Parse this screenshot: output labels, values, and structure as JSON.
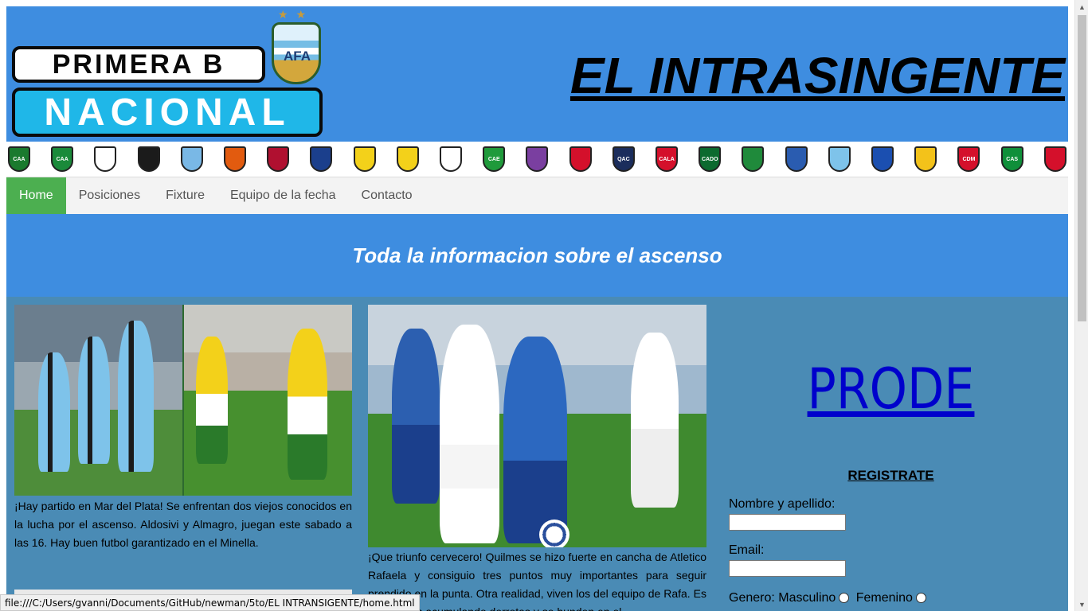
{
  "header": {
    "logo_line1": "PRIMERA B",
    "logo_line2": "NACIONAL",
    "logo_badge": "AFA",
    "site_title": "EL INTRASINGENTE"
  },
  "clubs": [
    {
      "name": "CAA",
      "color": "#1a7a2e"
    },
    {
      "name": "CAA",
      "color": "#1a8a3a"
    },
    {
      "name": "",
      "color": "#ffffff"
    },
    {
      "name": "",
      "color": "#1b1b1b"
    },
    {
      "name": "",
      "color": "#79b8e6"
    },
    {
      "name": "",
      "color": "#e25b0f"
    },
    {
      "name": "",
      "color": "#b01030"
    },
    {
      "name": "",
      "color": "#1b3f8c"
    },
    {
      "name": "",
      "color": "#f3d11a"
    },
    {
      "name": "",
      "color": "#f3d11a"
    },
    {
      "name": "",
      "color": "#ffffff"
    },
    {
      "name": "CAE",
      "color": "#1f9a3b"
    },
    {
      "name": "",
      "color": "#7a3fa0"
    },
    {
      "name": "",
      "color": "#d4102b"
    },
    {
      "name": "QAC",
      "color": "#1b2d5c"
    },
    {
      "name": "CALA",
      "color": "#d4102b"
    },
    {
      "name": "CADO",
      "color": "#0c6a2f"
    },
    {
      "name": "",
      "color": "#1f8a3b"
    },
    {
      "name": "",
      "color": "#2a5cb0"
    },
    {
      "name": "",
      "color": "#7ec3ea"
    },
    {
      "name": "",
      "color": "#1b4fb0"
    },
    {
      "name": "",
      "color": "#f3c21a"
    },
    {
      "name": "CDM",
      "color": "#d4102b"
    },
    {
      "name": "CAS",
      "color": "#0f8f3a"
    },
    {
      "name": "",
      "color": "#d4102b"
    }
  ],
  "nav": {
    "items": [
      "Home",
      "Posiciones",
      "Fixture",
      "Equipo de la fecha",
      "Contacto"
    ]
  },
  "banner": {
    "text": "Toda la informacion sobre el ascenso"
  },
  "articles": [
    {
      "text": "¡Hay partido en Mar del Plata! Se enfrentan dos viejos conocidos en la lucha por el ascenso. Aldosivi y Almagro, juegan este sabado a las 16. Hay buen futbol garantizado en el Minella."
    },
    {
      "text": "¡Que triunfo cervecero! Quilmes se hizo fuerte en cancha de Atletico Rafaela y consiguio tres puntos muy importantes para seguir prendido en la punta. Otra realidad, viven los del equipo de Rafa. Es que siguen acumulando derrotas y se hunden en el"
    }
  ],
  "prode": {
    "title": "PRODE",
    "register": "REGISTRATE",
    "name_label": "Nombre y apellido:",
    "email_label": "Email:",
    "gender_label": "Genero:",
    "male_label": "Masculino",
    "female_label": "Femenino"
  },
  "statusbar": {
    "url": "file:///C:/Users/gvanni/Documents/GitHub/newman/5to/EL INTRANSIGENTE/home.html"
  },
  "colors": {
    "header_blue": "#3e8de0",
    "content_blue": "#4a8bb5",
    "nav_active": "#4caf50",
    "prode_link": "#0000cc"
  }
}
